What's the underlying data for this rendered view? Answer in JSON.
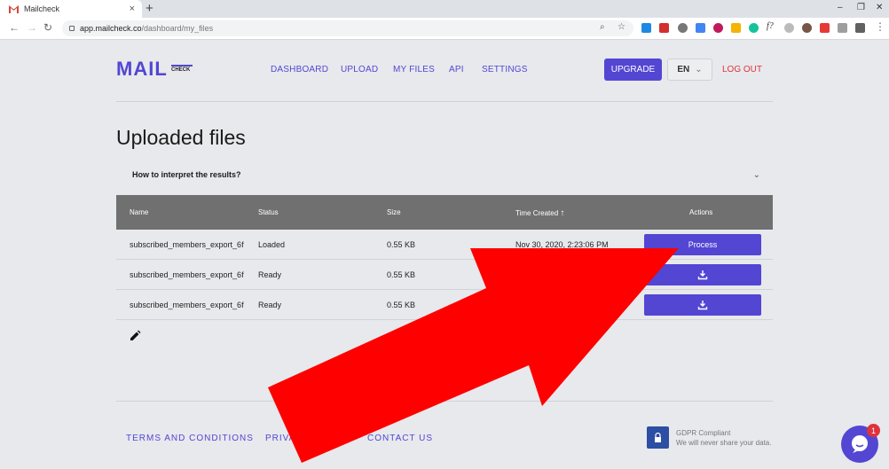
{
  "browser": {
    "tab_title": "Mailcheck",
    "tab_close": "×",
    "new_tab": "+",
    "url_host": "app.mailcheck.co",
    "url_path": "/dashboard/my_files",
    "win_min": "–",
    "win_max": "❐",
    "win_close": "✕"
  },
  "header": {
    "logo_main": "MAIL",
    "logo_sub": "CHECK",
    "nav": [
      "DASHBOARD",
      "UPLOAD",
      "MY FILES",
      "API",
      "SETTINGS"
    ],
    "upgrade": "UPGRADE",
    "language": "EN",
    "logout": "LOG OUT"
  },
  "page": {
    "title": "Uploaded files",
    "accordion_question": "How to interpret the results?"
  },
  "table": {
    "headers": {
      "name": "Name",
      "status": "Status",
      "size": "Size",
      "time": "Time Created",
      "actions": "Actions"
    },
    "sort_indicator": "↑",
    "rows": [
      {
        "name": "subscribed_members_export_6f",
        "status": "Loaded",
        "size": "0.55 KB",
        "time": "Nov 30, 2020, 2:23:06 PM",
        "action": "Process"
      },
      {
        "name": "subscribed_members_export_6f",
        "status": "Ready",
        "size": "0.55 KB",
        "time": "",
        "action": ""
      },
      {
        "name": "subscribed_members_export_6f",
        "status": "Ready",
        "size": "0.55 KB",
        "time": "",
        "action": ""
      }
    ]
  },
  "footer": {
    "terms": "TERMS AND CONDITIONS",
    "privacy": "PRIVA",
    "contact": "CONTACT US",
    "gdpr_title": "GDPR Compliant",
    "gdpr_text": "We will never share your data."
  },
  "chat": {
    "badge": "1"
  },
  "colors": {
    "brand": "#5346d3",
    "logout": "#e0323c",
    "table_header": "#707070",
    "arrow": "#ff0000"
  }
}
